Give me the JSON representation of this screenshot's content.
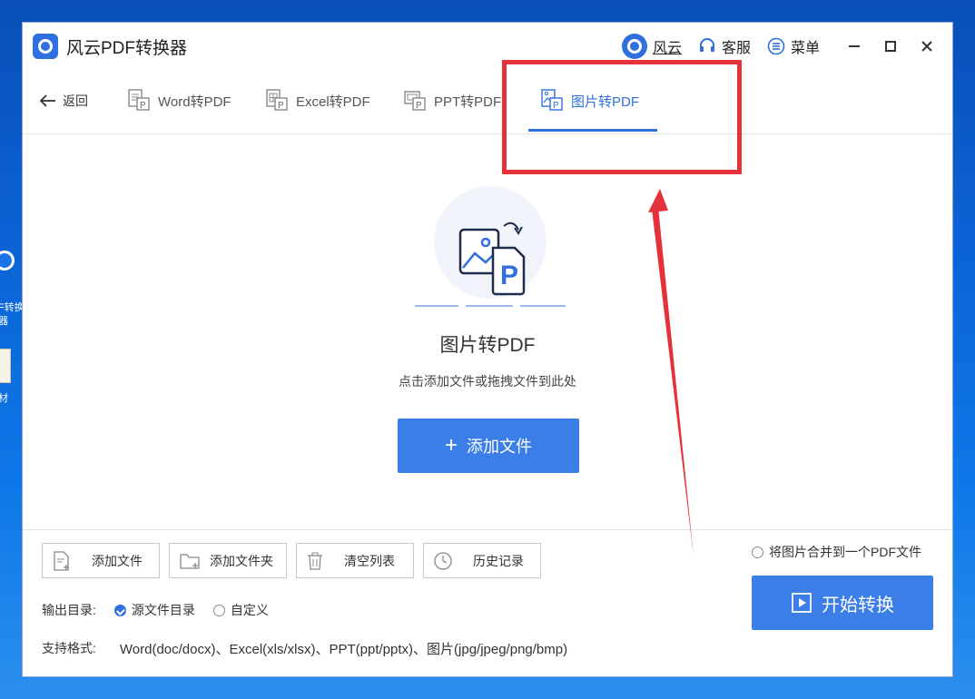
{
  "desktop": {
    "icon1_label_line1": "F转换",
    "icon1_label_line2": "器",
    "icon2_label": "材"
  },
  "titlebar": {
    "app_title": "风云PDF转换器",
    "user_name": "风云",
    "service_label": "客服",
    "menu_label": "菜单"
  },
  "tabs": {
    "back_label": "返回",
    "items": [
      {
        "label": "Word转PDF"
      },
      {
        "label": "Excel转PDF"
      },
      {
        "label": "PPT转PDF"
      },
      {
        "label": "图片转PDF"
      }
    ],
    "active": "图片转PDF"
  },
  "dropzone": {
    "title": "图片转PDF",
    "hint": "点击添加文件或拖拽文件到此处",
    "add_button": "添加文件"
  },
  "toolbar": {
    "add_file": "添加文件",
    "add_folder": "添加文件夹",
    "clear_list": "清空列表",
    "history": "历史记录"
  },
  "options": {
    "merge_label": "将图片合并到一个PDF文件",
    "merge_checked": false,
    "start_button": "开始转换",
    "output_label": "输出目录:",
    "output_source": "源文件目录",
    "output_custom": "自定义",
    "output_selected": "源文件目录",
    "formats_label": "支持格式:",
    "formats_value": "Word(doc/docx)、Excel(xls/xlsx)、PPT(ppt/pptx)、图片(jpg/jpeg/png/bmp)"
  },
  "colors": {
    "accent": "#3c7ee8",
    "annotation_red": "#e5323a",
    "desktop_blue": "#0b63d6"
  }
}
